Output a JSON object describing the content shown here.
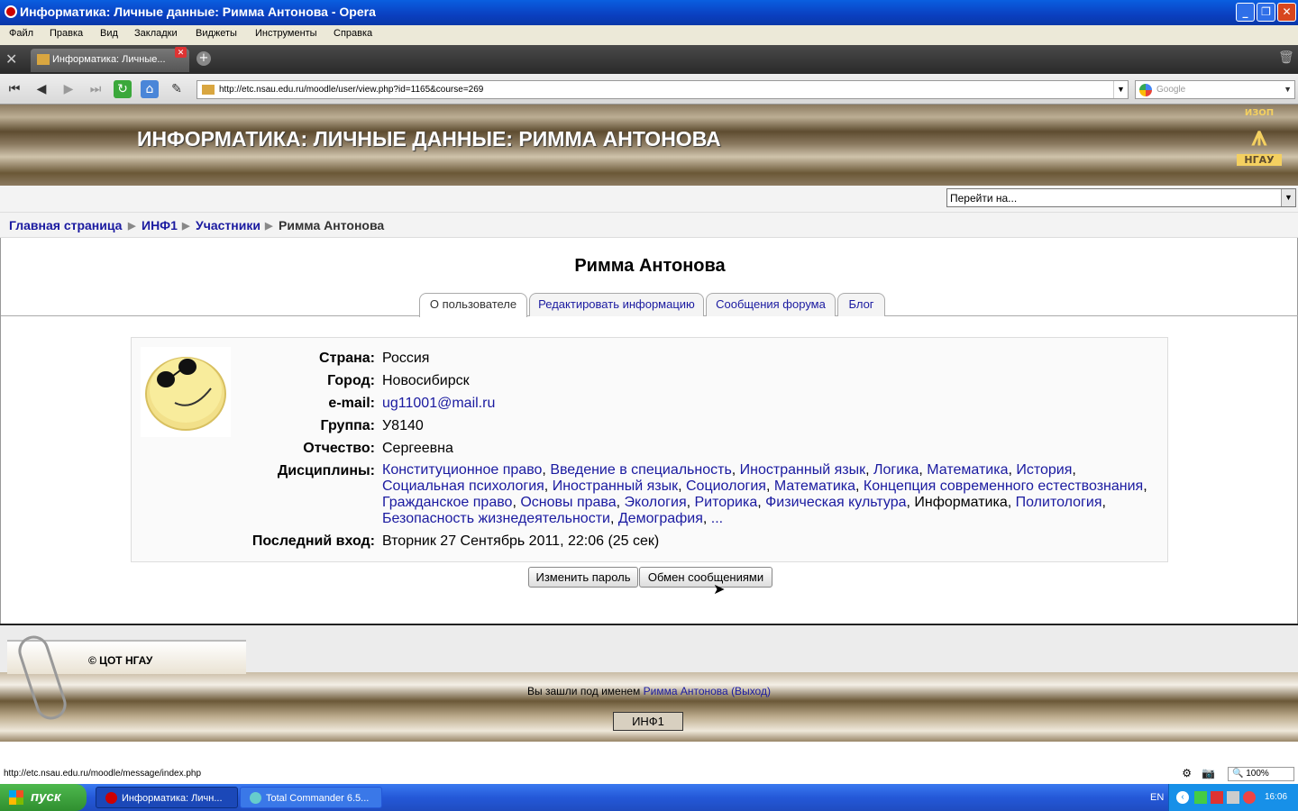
{
  "window": {
    "title": "Информатика: Личные данные: Римма Антонова - Opera"
  },
  "menu": [
    "Файл",
    "Правка",
    "Вид",
    "Закладки",
    "Виджеты",
    "Инструменты",
    "Справка"
  ],
  "tab": {
    "label": "Информатика: Личные..."
  },
  "address": {
    "url": "http://etc.nsau.edu.ru/moodle/user/view.php?id=1165&course=269",
    "search_placeholder": "Google"
  },
  "header": {
    "title": "ИНФОРМАТИКА: ЛИЧНЫЕ ДАННЫЕ: РИММА АНТОНОВА",
    "logo_top": "ИЗОП",
    "logo_bottom": "НГАУ"
  },
  "jump": {
    "label": "Перейти на..."
  },
  "breadcrumb": {
    "home": "Главная страница",
    "course": "ИНФ1",
    "participants": "Участники",
    "current": "Римма Антонова"
  },
  "profile": {
    "name": "Римма Антонова",
    "tabs": [
      "О пользователе",
      "Редактировать информацию",
      "Сообщения форума",
      "Блог"
    ],
    "fields": {
      "country_label": "Страна:",
      "country": "Россия",
      "city_label": "Город:",
      "city": "Новосибирск",
      "email_label": "e-mail:",
      "email": "ug11001@mail.ru",
      "group_label": "Группа:",
      "group": "У8140",
      "patronymic_label": "Отчество:",
      "patronymic": "Сергеевна",
      "courses_label": "Дисциплины:",
      "lastaccess_label": "Последний вход:",
      "lastaccess": "Вторник 27 Сентябрь 2011, 22:06  (25 сек)"
    },
    "courses": [
      "Конституционное право",
      "Введение в специальность",
      "Иностранный язык",
      "Логика",
      "Математика",
      "История",
      "Социальная психология",
      "Иностранный язык",
      "Социология",
      "Математика",
      "Концепция современного естествознания",
      "Гражданское право",
      "Основы права",
      "Экология",
      "Риторика",
      "Физическая культура",
      "Информатика",
      "Политология",
      "Безопасность жизнедеятельности",
      "Демография",
      "..."
    ],
    "buttons": {
      "change_password": "Изменить пароль",
      "messages": "Обмен сообщениями"
    }
  },
  "footer": {
    "copyright": "© ЦОТ НГАУ",
    "logged_prefix": "Вы зашли под именем",
    "user": "Римма Антонова",
    "logout": "(Выход)",
    "course_button": "ИНФ1"
  },
  "status": {
    "url": "http://etc.nsau.edu.ru/moodle/message/index.php",
    "zoom": "100%"
  },
  "taskbar": {
    "start": "пуск",
    "items": [
      "Информатика: Личн...",
      "Total Commander 6.5..."
    ],
    "lang": "EN",
    "time": "16:06"
  }
}
